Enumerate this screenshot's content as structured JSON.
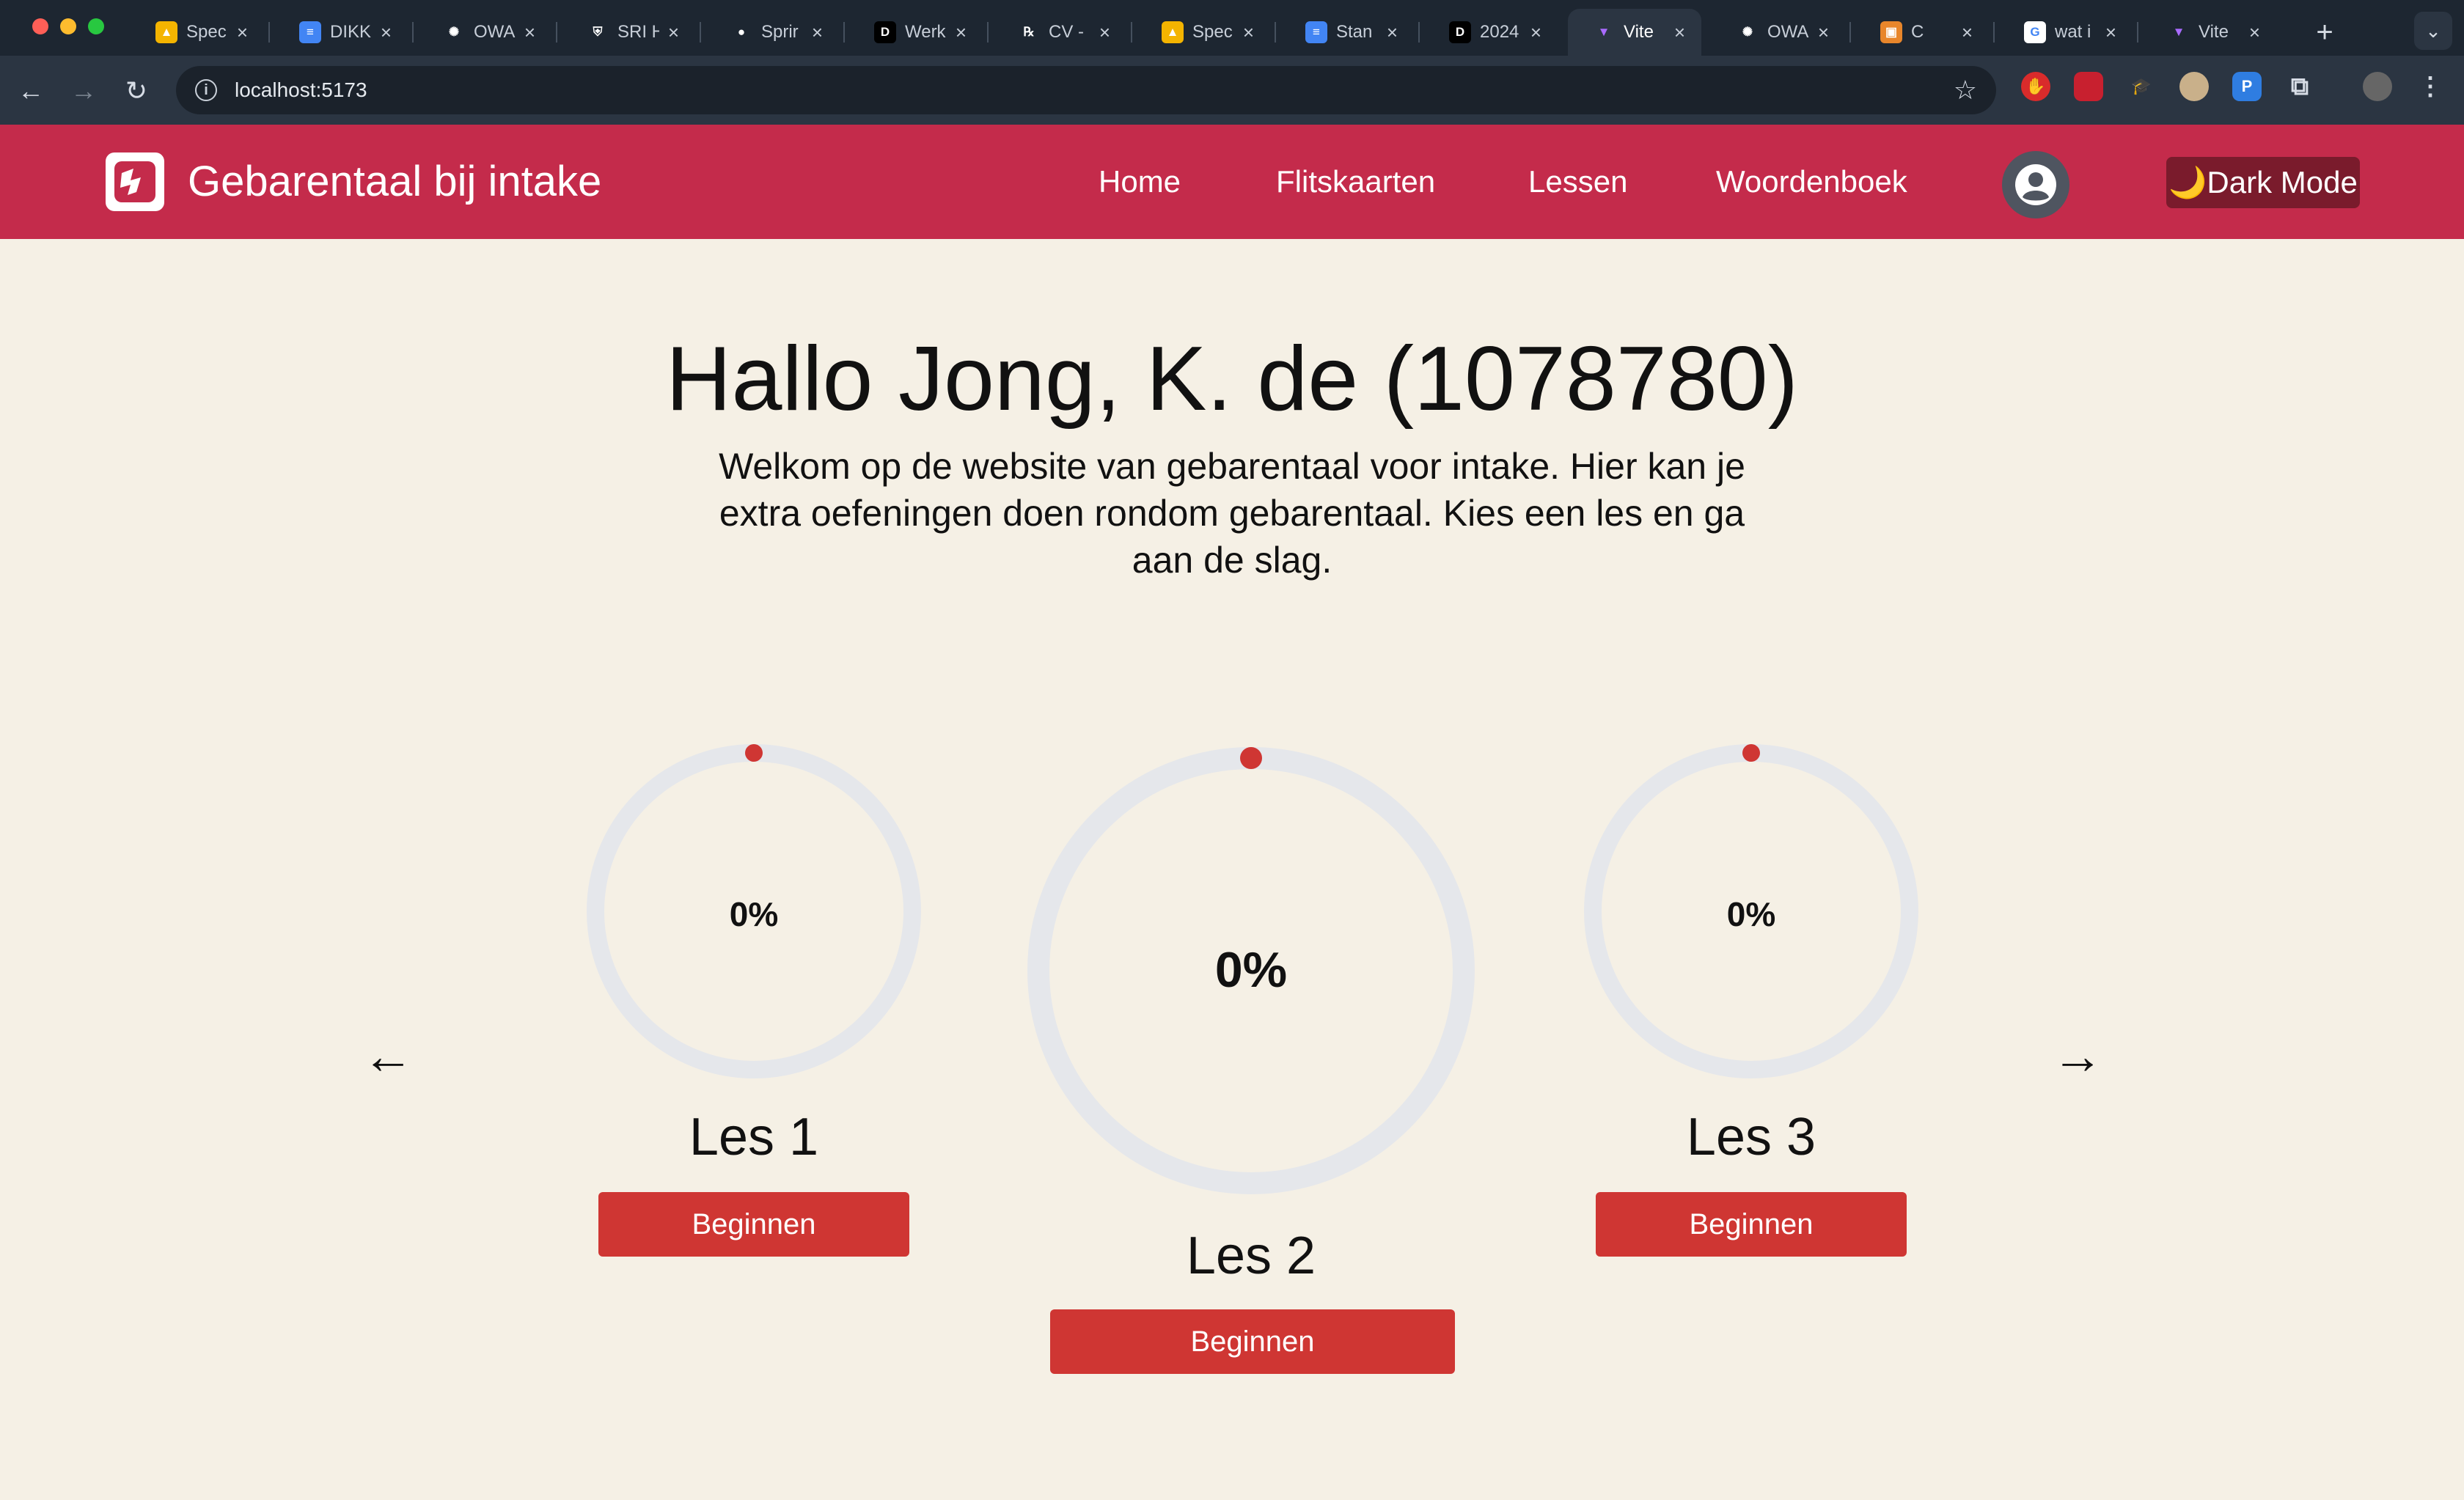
{
  "browser": {
    "tabs": [
      {
        "title": "Spec",
        "icon": "google-drive-icon"
      },
      {
        "title": "DIKK",
        "icon": "google-docs-icon"
      },
      {
        "title": "OWA",
        "icon": "openai-icon"
      },
      {
        "title": "SRI H",
        "icon": "shield-icon"
      },
      {
        "title": "Sprir",
        "icon": "github-icon"
      },
      {
        "title": "Werk",
        "icon": "d2l-icon"
      },
      {
        "title": "CV -",
        "icon": "rx-icon"
      },
      {
        "title": "Spec",
        "icon": "google-drive-icon"
      },
      {
        "title": "Stan",
        "icon": "google-docs-icon"
      },
      {
        "title": "2024",
        "icon": "d2l-icon"
      },
      {
        "title": "Vite",
        "icon": "vite-icon",
        "active": true
      },
      {
        "title": "OWA",
        "icon": "openai-icon"
      },
      {
        "title": "C",
        "icon": "extension-icon"
      },
      {
        "title": "wat i",
        "icon": "google-icon"
      },
      {
        "title": "Vite",
        "icon": "vite-icon"
      }
    ],
    "url": "localhost:5173"
  },
  "header": {
    "title": "Gebarentaal bij intake",
    "nav": [
      "Home",
      "Flitskaarten",
      "Lessen",
      "Woordenboek"
    ],
    "dark_mode_label": "🌙Dark Mode"
  },
  "main": {
    "greeting": "Hallo Jong, K. de (1078780)",
    "intro": "Welkom op de website van gebarentaal voor intake. Hier kan je extra oefeningen doen rondom gebarentaal. Kies een les en ga aan de slag.",
    "lessons": [
      {
        "name": "Les 1",
        "progress_label": "0%",
        "progress": 0,
        "button": "Beginnen"
      },
      {
        "name": "Les 2",
        "progress_label": "0%",
        "progress": 0,
        "button": "Beginnen"
      },
      {
        "name": "Les 3",
        "progress_label": "0%",
        "progress": 0,
        "button": "Beginnen"
      }
    ]
  },
  "colors": {
    "header": "#c42b4b",
    "background": "#f5f0e5",
    "button": "#cf3633",
    "ring_track": "#e5e7eb"
  }
}
